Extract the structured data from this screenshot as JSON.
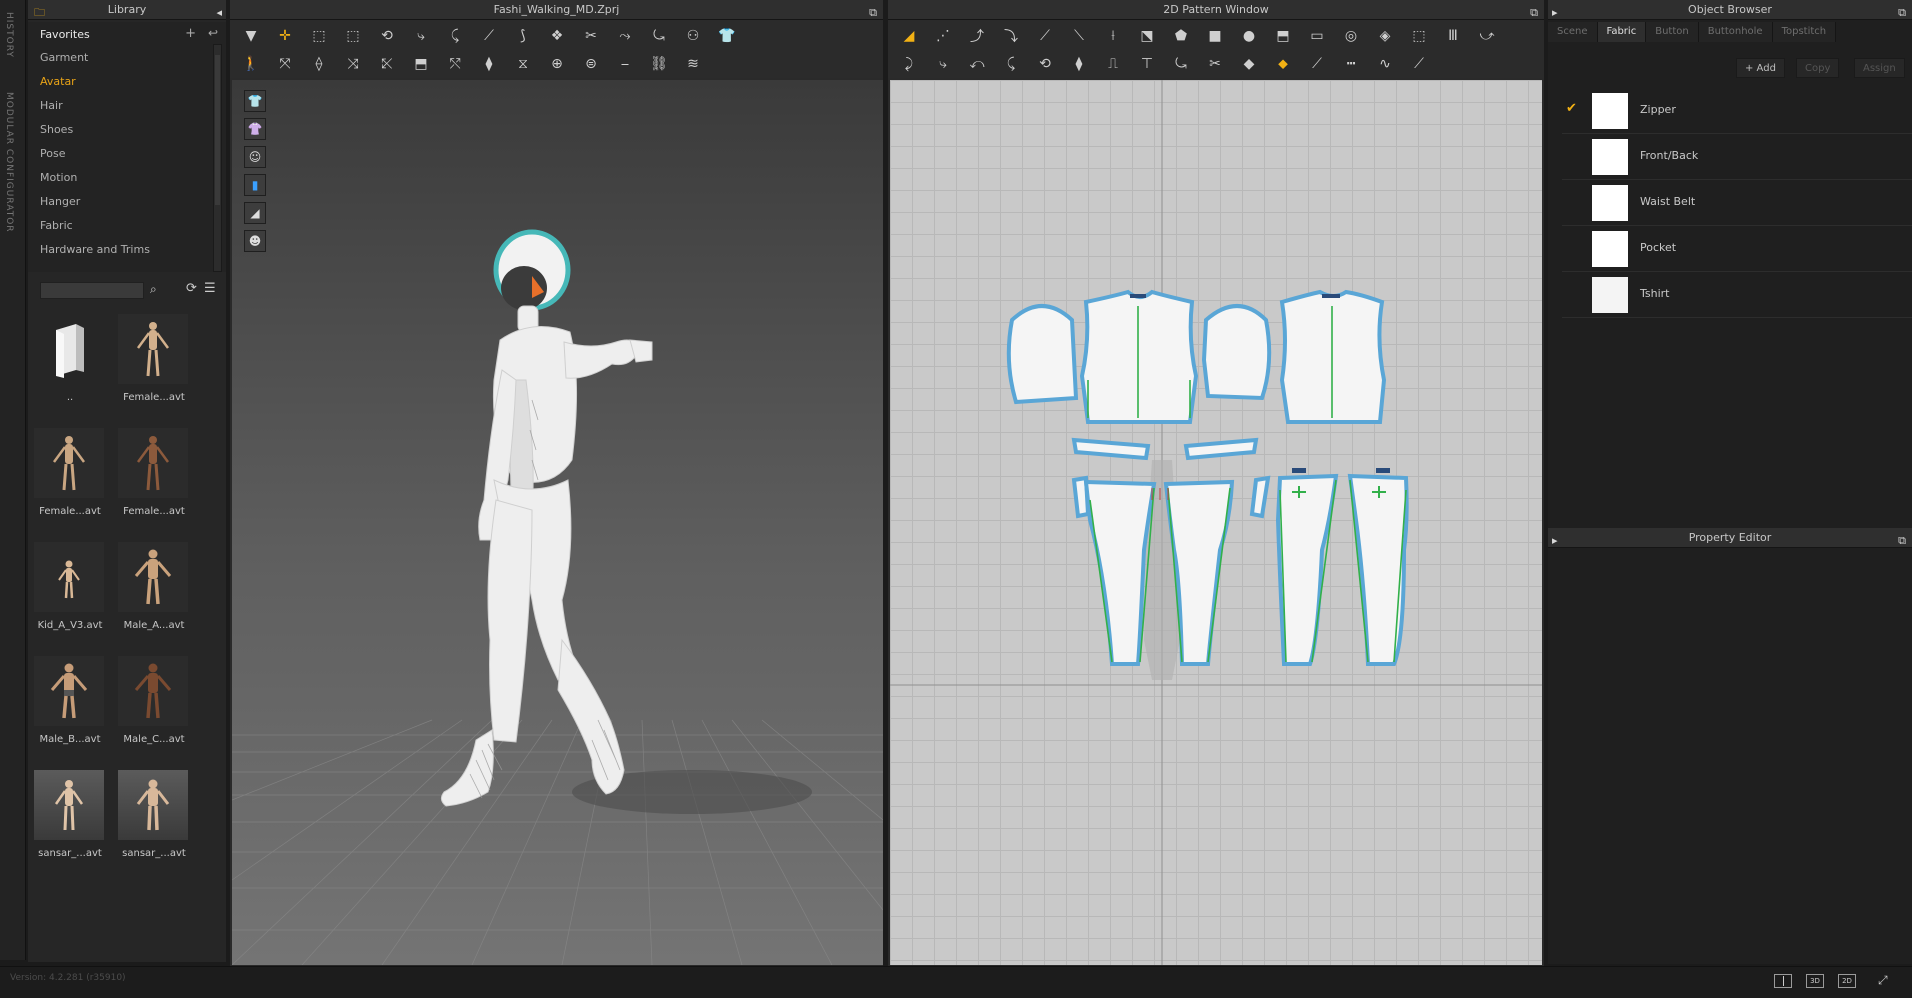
{
  "vertical_strip": {
    "labels": [
      "HISTORY",
      "MODULAR CONFIGURATOR"
    ]
  },
  "library": {
    "title": "Library",
    "favorites_label": "Favorites",
    "menu": [
      "Garment",
      "Avatar",
      "Hair",
      "Shoes",
      "Pose",
      "Motion",
      "Hanger",
      "Fabric",
      "Hardware and Trims"
    ],
    "active_menu": "Avatar",
    "search": {
      "value": "",
      "placeholder": ""
    },
    "items": [
      {
        "label": "..",
        "kind": "folder"
      },
      {
        "label": "Female...avt",
        "kind": "avatar"
      },
      {
        "label": "Female...avt",
        "kind": "avatar"
      },
      {
        "label": "Female...avt",
        "kind": "avatar"
      },
      {
        "label": "Kid_A_V3.avt",
        "kind": "avatar"
      },
      {
        "label": "Male_A...avt",
        "kind": "avatar"
      },
      {
        "label": "Male_B...avt",
        "kind": "avatar"
      },
      {
        "label": "Male_C...avt",
        "kind": "avatar"
      },
      {
        "label": "sansar_...avt",
        "kind": "avatar"
      },
      {
        "label": "sansar_...avt",
        "kind": "avatar"
      }
    ]
  },
  "window3d": {
    "title": "Fashi_Walking_MD.Zprj"
  },
  "window2d": {
    "title": "2D Pattern Window"
  },
  "object_browser": {
    "title": "Object Browser",
    "tabs": [
      "Scene",
      "Fabric",
      "Button",
      "Buttonhole",
      "Topstitch"
    ],
    "active_tab": "Fabric",
    "actions": {
      "add": "+ Add",
      "copy": "Copy",
      "assign": "Assign"
    },
    "fabrics": [
      {
        "name": "Zipper",
        "selected": true,
        "color": "#ffffff"
      },
      {
        "name": "Front/Back",
        "selected": false,
        "color": "#ffffff"
      },
      {
        "name": "Waist Belt",
        "selected": false,
        "color": "#ffffff"
      },
      {
        "name": "Pocket",
        "selected": false,
        "color": "#ffffff"
      },
      {
        "name": "Tshirt",
        "selected": false,
        "color": "#f4f4f4"
      }
    ]
  },
  "property_editor": {
    "title": "Property Editor"
  },
  "statusbar": {
    "version": "Version: 4.2.281 (r35910)",
    "view_modes": [
      "",
      "3D",
      "2D"
    ]
  },
  "colors": {
    "accent": "#f2b114",
    "pattern_outline": "#5aa6d6",
    "seam": "#32b04a"
  }
}
